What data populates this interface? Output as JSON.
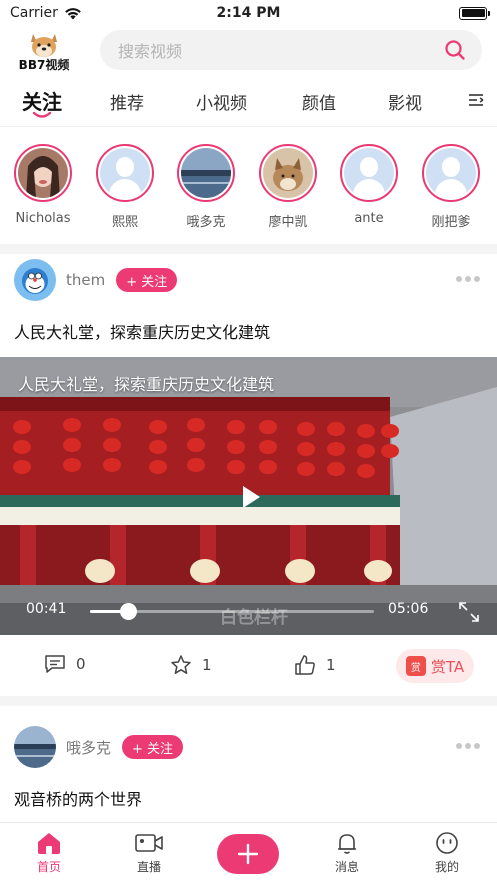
{
  "status_bar": {
    "carrier": "Carrier",
    "time": "2:14 PM"
  },
  "header": {
    "logo_text": "BB7视频",
    "search_placeholder": "搜索视频"
  },
  "tabs": [
    {
      "label": "关注",
      "active": true
    },
    {
      "label": "推荐",
      "active": false
    },
    {
      "label": "小视频",
      "active": false
    },
    {
      "label": "颜值",
      "active": false
    },
    {
      "label": "影视",
      "active": false
    }
  ],
  "stories": [
    {
      "name": "Nicholas",
      "avatar": "photo-woman"
    },
    {
      "name": "熙熙",
      "avatar": "default-avatar"
    },
    {
      "name": "哦多克",
      "avatar": "photo-lake"
    },
    {
      "name": "廖中凯",
      "avatar": "photo-dog"
    },
    {
      "name": "ante",
      "avatar": "default-avatar"
    },
    {
      "name": "刚把爹",
      "avatar": "default-avatar"
    }
  ],
  "posts": [
    {
      "user": "them",
      "follow_label": "+ 关注",
      "title": "人民大礼堂，探索重庆历史文化建筑",
      "video": {
        "overlay_title": "人民大礼堂，探索重庆历史文化建筑",
        "watermark": "白色栏杆",
        "current_time": "00:41",
        "duration": "05:06",
        "progress": 0.134
      },
      "comments": "0",
      "favorites": "1",
      "likes": "1",
      "reward_label": "赏TA",
      "reward_badge": "赏"
    },
    {
      "user": "哦多克",
      "follow_label": "+ 关注",
      "title": "观音桥的两个世界"
    }
  ],
  "bottom_nav": [
    {
      "label": "首页",
      "icon": "home-icon",
      "active": true
    },
    {
      "label": "直播",
      "icon": "video-camera-icon",
      "active": false
    },
    {
      "label": "消息",
      "icon": "bell-icon",
      "active": false
    },
    {
      "label": "我的",
      "icon": "face-icon",
      "active": false
    }
  ],
  "colors": {
    "accent": "#ec3a74",
    "reward_bg": "#fde9ea",
    "reward_text": "#e8505b"
  }
}
